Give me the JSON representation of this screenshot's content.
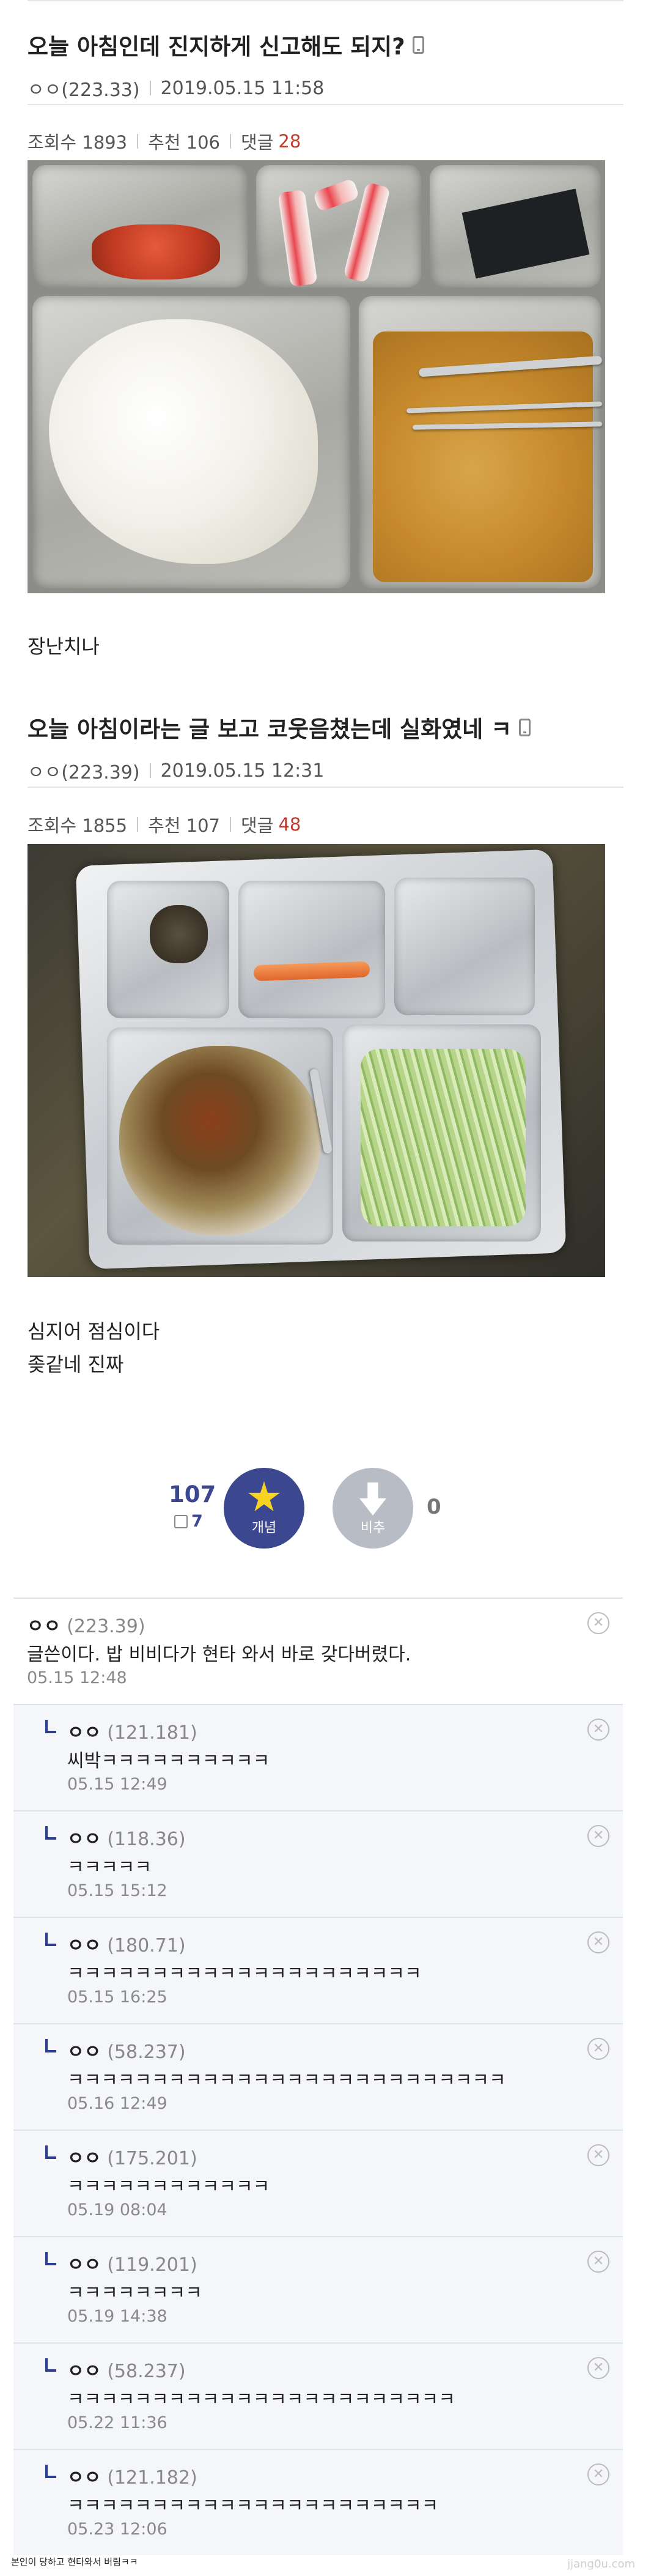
{
  "post1": {
    "title": "오늘 아침인데 진지하게 신고해도 되지?",
    "author": "ㅇㅇ(223.33)",
    "date": "2019.05.15 11:58",
    "views_label": "조회수 1893",
    "recommend_label": "추천 106",
    "comments_label": "댓글",
    "comments_count": "28",
    "body": "장난치나"
  },
  "post2": {
    "title": "오늘 아침이라는 글 보고 코웃음쳤는데 실화였네 ㅋ",
    "author": "ㅇㅇ(223.39)",
    "date": "2019.05.15 12:31",
    "views_label": "조회수 1855",
    "recommend_label": "추천 107",
    "comments_label": "댓글",
    "comments_count": "48",
    "body_line1": "심지어 점심이다",
    "body_line2": "좆같네 진짜"
  },
  "vote": {
    "up_count": "107",
    "fix_count": "7",
    "up_label": "개념",
    "down_label": "비추",
    "down_count": "0",
    "up_color": "#3b4890",
    "down_color": "#b8bcc5"
  },
  "comments": [
    {
      "author": "ㅇㅇ",
      "ip": "(223.39)",
      "text": "글쓴이다. 밥 비비다가 현타 와서 바로 갖다버렸다.",
      "date": "05.15 12:48"
    },
    {
      "author": "ㅇㅇ",
      "ip": "(121.181)",
      "text": "씨박ㅋㅋㅋㅋㅋㅋㅋㅋㅋㅋ",
      "date": "05.15 12:49"
    },
    {
      "author": "ㅇㅇ",
      "ip": "(118.36)",
      "text": "ㅋㅋㅋㅋㅋ",
      "date": "05.15 15:12"
    },
    {
      "author": "ㅇㅇ",
      "ip": "(180.71)",
      "text": "ㅋㅋㅋㅋㅋㅋㅋㅋㅋㅋㅋㅋㅋㅋㅋㅋㅋㅋㅋㅋㅋ",
      "date": "05.15 16:25"
    },
    {
      "author": "ㅇㅇ",
      "ip": "(58.237)",
      "text": "ㅋㅋㅋㅋㅋㅋㅋㅋㅋㅋㅋㅋㅋㅋㅋㅋㅋㅋㅋㅋㅋㅋㅋㅋㅋㅋ",
      "date": "05.16 12:49"
    },
    {
      "author": "ㅇㅇ",
      "ip": "(175.201)",
      "text": "ㅋㅋㅋㅋㅋㅋㅋㅋㅋㅋㅋㅋ",
      "date": "05.19 08:04"
    },
    {
      "author": "ㅇㅇ",
      "ip": "(119.201)",
      "text": "ㅋㅋㅋㅋㅋㅋㅋㅋ",
      "date": "05.19 14:38"
    },
    {
      "author": "ㅇㅇ",
      "ip": "(58.237)",
      "text": "ㅋㅋㅋㅋㅋㅋㅋㅋㅋㅋㅋㅋㅋㅋㅋㅋㅋㅋㅋㅋㅋㅋㅋ",
      "date": "05.22 11:36"
    },
    {
      "author": "ㅇㅇ",
      "ip": "(121.182)",
      "text": "ㅋㅋㅋㅋㅋㅋㅋㅋㅋㅋㅋㅋㅋㅋㅋㅋㅋㅋㅋㅋㅋㅋ",
      "date": "05.23 12:06"
    }
  ],
  "footer": {
    "caption": "본인이 당하고 현타와서 버림ㅋㅋ",
    "watermark": "jjang0u.com"
  },
  "icons": {
    "mobile": "mobile-phone-icon",
    "up": "star-icon",
    "down": "down-arrow-icon",
    "delete": "close-circle-icon",
    "reply": "reply-arrow-icon",
    "fix": "pencil-note-icon"
  }
}
